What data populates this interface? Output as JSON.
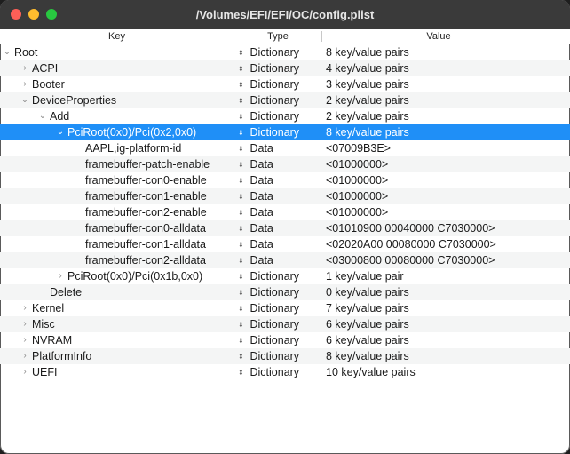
{
  "window": {
    "title": "/Volumes/EFI/EFI/OC/config.plist"
  },
  "columns": {
    "key": "Key",
    "type": "Type",
    "value": "Value"
  },
  "glyphs": {
    "updown": "⇕"
  },
  "rows": [
    {
      "key": "Root",
      "type": "Dictionary",
      "value": "8 key/value pairs",
      "depth": 0,
      "disclosure": "open",
      "selected": false
    },
    {
      "key": "ACPI",
      "type": "Dictionary",
      "value": "4 key/value pairs",
      "depth": 1,
      "disclosure": "closed",
      "selected": false
    },
    {
      "key": "Booter",
      "type": "Dictionary",
      "value": "3 key/value pairs",
      "depth": 1,
      "disclosure": "closed",
      "selected": false
    },
    {
      "key": "DeviceProperties",
      "type": "Dictionary",
      "value": "2 key/value pairs",
      "depth": 1,
      "disclosure": "open",
      "selected": false
    },
    {
      "key": "Add",
      "type": "Dictionary",
      "value": "2 key/value pairs",
      "depth": 2,
      "disclosure": "open",
      "selected": false
    },
    {
      "key": "PciRoot(0x0)/Pci(0x2,0x0)",
      "type": "Dictionary",
      "value": "8 key/value pairs",
      "depth": 3,
      "disclosure": "open",
      "selected": true
    },
    {
      "key": "AAPL,ig-platform-id",
      "type": "Data",
      "value": "<07009B3E>",
      "depth": 4,
      "disclosure": "none",
      "selected": false
    },
    {
      "key": "framebuffer-patch-enable",
      "type": "Data",
      "value": "<01000000>",
      "depth": 4,
      "disclosure": "none",
      "selected": false
    },
    {
      "key": "framebuffer-con0-enable",
      "type": "Data",
      "value": "<01000000>",
      "depth": 4,
      "disclosure": "none",
      "selected": false
    },
    {
      "key": "framebuffer-con1-enable",
      "type": "Data",
      "value": "<01000000>",
      "depth": 4,
      "disclosure": "none",
      "selected": false
    },
    {
      "key": "framebuffer-con2-enable",
      "type": "Data",
      "value": "<01000000>",
      "depth": 4,
      "disclosure": "none",
      "selected": false
    },
    {
      "key": "framebuffer-con0-alldata",
      "type": "Data",
      "value": "<01010900 00040000 C7030000>",
      "depth": 4,
      "disclosure": "none",
      "selected": false
    },
    {
      "key": "framebuffer-con1-alldata",
      "type": "Data",
      "value": "<02020A00 00080000 C7030000>",
      "depth": 4,
      "disclosure": "none",
      "selected": false
    },
    {
      "key": "framebuffer-con2-alldata",
      "type": "Data",
      "value": "<03000800 00080000 C7030000>",
      "depth": 4,
      "disclosure": "none",
      "selected": false
    },
    {
      "key": "PciRoot(0x0)/Pci(0x1b,0x0)",
      "type": "Dictionary",
      "value": "1 key/value pair",
      "depth": 3,
      "disclosure": "closed",
      "selected": false
    },
    {
      "key": "Delete",
      "type": "Dictionary",
      "value": "0 key/value pairs",
      "depth": 2,
      "disclosure": "none",
      "selected": false
    },
    {
      "key": "Kernel",
      "type": "Dictionary",
      "value": "7 key/value pairs",
      "depth": 1,
      "disclosure": "closed",
      "selected": false
    },
    {
      "key": "Misc",
      "type": "Dictionary",
      "value": "6 key/value pairs",
      "depth": 1,
      "disclosure": "closed",
      "selected": false
    },
    {
      "key": "NVRAM",
      "type": "Dictionary",
      "value": "6 key/value pairs",
      "depth": 1,
      "disclosure": "closed",
      "selected": false
    },
    {
      "key": "PlatformInfo",
      "type": "Dictionary",
      "value": "8 key/value pairs",
      "depth": 1,
      "disclosure": "closed",
      "selected": false
    },
    {
      "key": "UEFI",
      "type": "Dictionary",
      "value": "10 key/value pairs",
      "depth": 1,
      "disclosure": "closed",
      "selected": false
    }
  ]
}
